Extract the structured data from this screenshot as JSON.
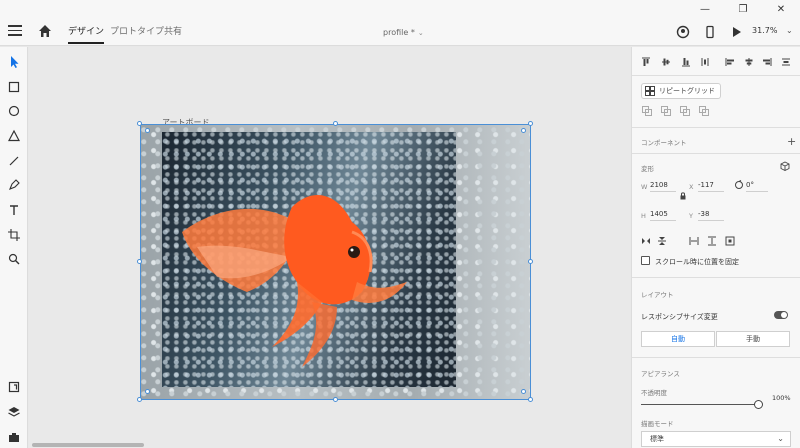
{
  "window": {
    "minimize": "—",
    "restore": "❐",
    "close": "✕"
  },
  "header": {
    "tabs": [
      {
        "label": "デザイン"
      },
      {
        "label": "プロトタイプ"
      },
      {
        "label": "共有"
      }
    ],
    "doc_title": "profile *",
    "zoom": "31.7%"
  },
  "canvas": {
    "artboard_label": "アートボード"
  },
  "panel": {
    "repeat_grid_label": "リピートグリッド",
    "component_title": "コンポーネント",
    "transform_title": "変形",
    "w_label": "W",
    "w_value": "2108",
    "x_label": "X",
    "x_value": "-117",
    "rot_value": "0°",
    "h_label": "H",
    "h_value": "1405",
    "y_label": "Y",
    "y_value": "-38",
    "fix_scroll_label": "スクロール時に位置を固定",
    "layout_title": "レイアウト",
    "responsive_label": "レスポンシブサイズ変更",
    "auto_label": "自動",
    "manual_label": "手動",
    "appearance_title": "アピアランス",
    "opacity_label": "不透明度",
    "opacity_value": "100%",
    "opacity_level": 1.0,
    "blend_label": "描画モード",
    "blend_value": "標準"
  },
  "colors": {
    "accent": "#1473e6",
    "selection": "#4a8fd6",
    "fish": "#ff5a1f"
  }
}
